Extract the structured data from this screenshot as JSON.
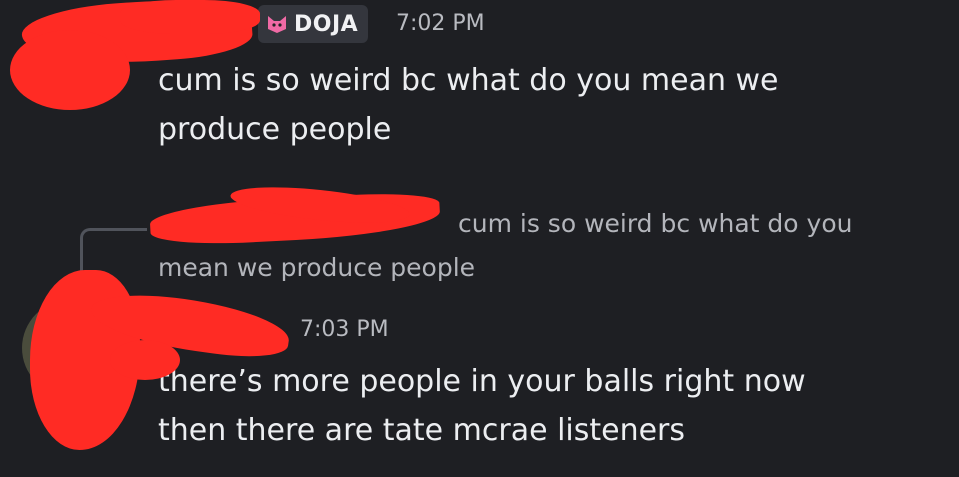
{
  "messages": [
    {
      "author_tag": "DOJA",
      "tag_icon": "cat-icon",
      "time": "7:02 PM",
      "text_line1": "cum is so weird bc what do you mean we",
      "text_line2": "produce people"
    },
    {
      "reply_preview_line1": "cum is so weird bc what do you",
      "reply_preview_line2": "mean we produce people",
      "reply_icon": "cat-icon",
      "time": "7:03 PM",
      "text_line1": "there’s more people in your balls right now",
      "text_line2": "then there are tate mcrae listeners"
    }
  ],
  "colors": {
    "background": "#1e1f23",
    "redaction": "#ff2b24",
    "tag_bg": "#34363d"
  }
}
